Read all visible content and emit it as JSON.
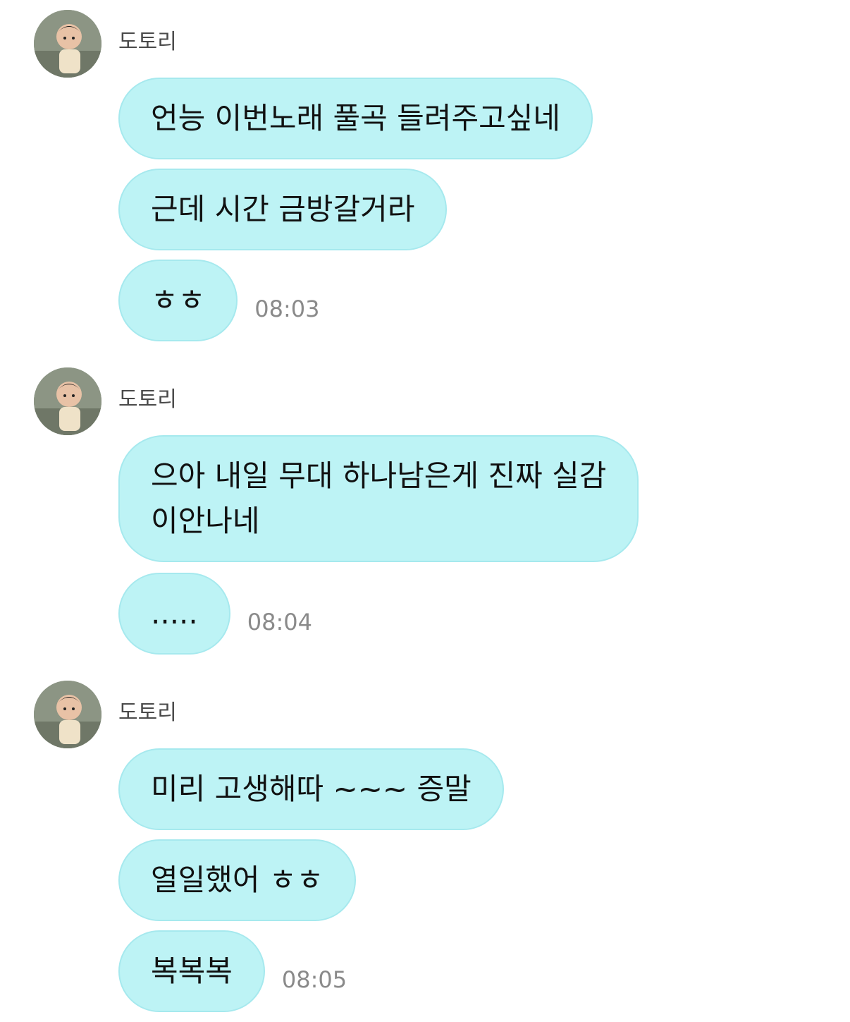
{
  "chat": {
    "groups": [
      {
        "sender": "도토리",
        "avatar_icon": "child-photo-avatar",
        "messages": [
          {
            "text": "언능 이번노래 풀곡 들려주고싶네",
            "time": ""
          },
          {
            "text": "근데 시간 금방갈거라",
            "time": ""
          },
          {
            "text": "ㅎㅎ",
            "time": "08:03"
          }
        ]
      },
      {
        "sender": "도토리",
        "avatar_icon": "child-photo-avatar",
        "messages": [
          {
            "text": "으아 내일 무대 하나남은게 진짜 실감\n이안나네",
            "time": ""
          },
          {
            "text": ".....",
            "time": "08:04"
          }
        ]
      },
      {
        "sender": "도토리",
        "avatar_icon": "child-photo-avatar",
        "messages": [
          {
            "text": "미리 고생해따 ~~~ 증말",
            "time": ""
          },
          {
            "text": "열일했어 ㅎㅎ",
            "time": ""
          },
          {
            "text": "복복복",
            "time": "08:05"
          }
        ]
      }
    ]
  },
  "colors": {
    "bubble_bg": "#bdf3f5",
    "bubble_border": "#a6e9ee",
    "timestamp": "#8a8a8a",
    "sender": "#4a4a4a"
  }
}
